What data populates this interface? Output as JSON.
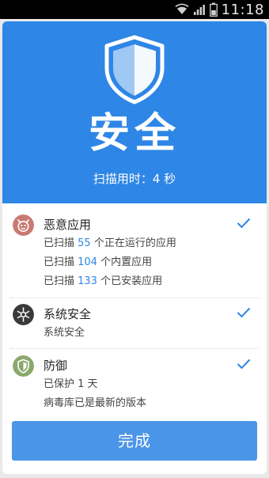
{
  "status_bar": {
    "time": "11:18"
  },
  "header": {
    "title": "安全",
    "scan_time": "扫描用时：4 秒",
    "color": "#2e86e6"
  },
  "sections": [
    {
      "title": "恶意应用",
      "icon": "malware-devil-icon",
      "icon_color": "#c97a72",
      "checked": true,
      "lines": [
        {
          "prefix": "已扫描 ",
          "count": "55",
          "suffix": " 个正在运行的应用"
        },
        {
          "prefix": "已扫描 ",
          "count": "104",
          "suffix": " 个内置应用"
        },
        {
          "prefix": "已扫描 ",
          "count": "133",
          "suffix": " 个已安装应用"
        }
      ]
    },
    {
      "title": "系统安全",
      "icon": "system-security-icon",
      "icon_color": "#3a3a3a",
      "checked": true,
      "lines": [
        {
          "text": "系统安全"
        }
      ]
    },
    {
      "title": "防御",
      "icon": "defense-shield-icon",
      "icon_color": "#8aa86b",
      "checked": true,
      "lines": [
        {
          "text": "已保护 1 天"
        },
        {
          "text": "病毒库已是最新的版本"
        }
      ]
    }
  ],
  "footer": {
    "done_label": "完成"
  },
  "colors": {
    "accent": "#2e86e6",
    "button": "#4a95e8",
    "check": "#2e86e6"
  }
}
